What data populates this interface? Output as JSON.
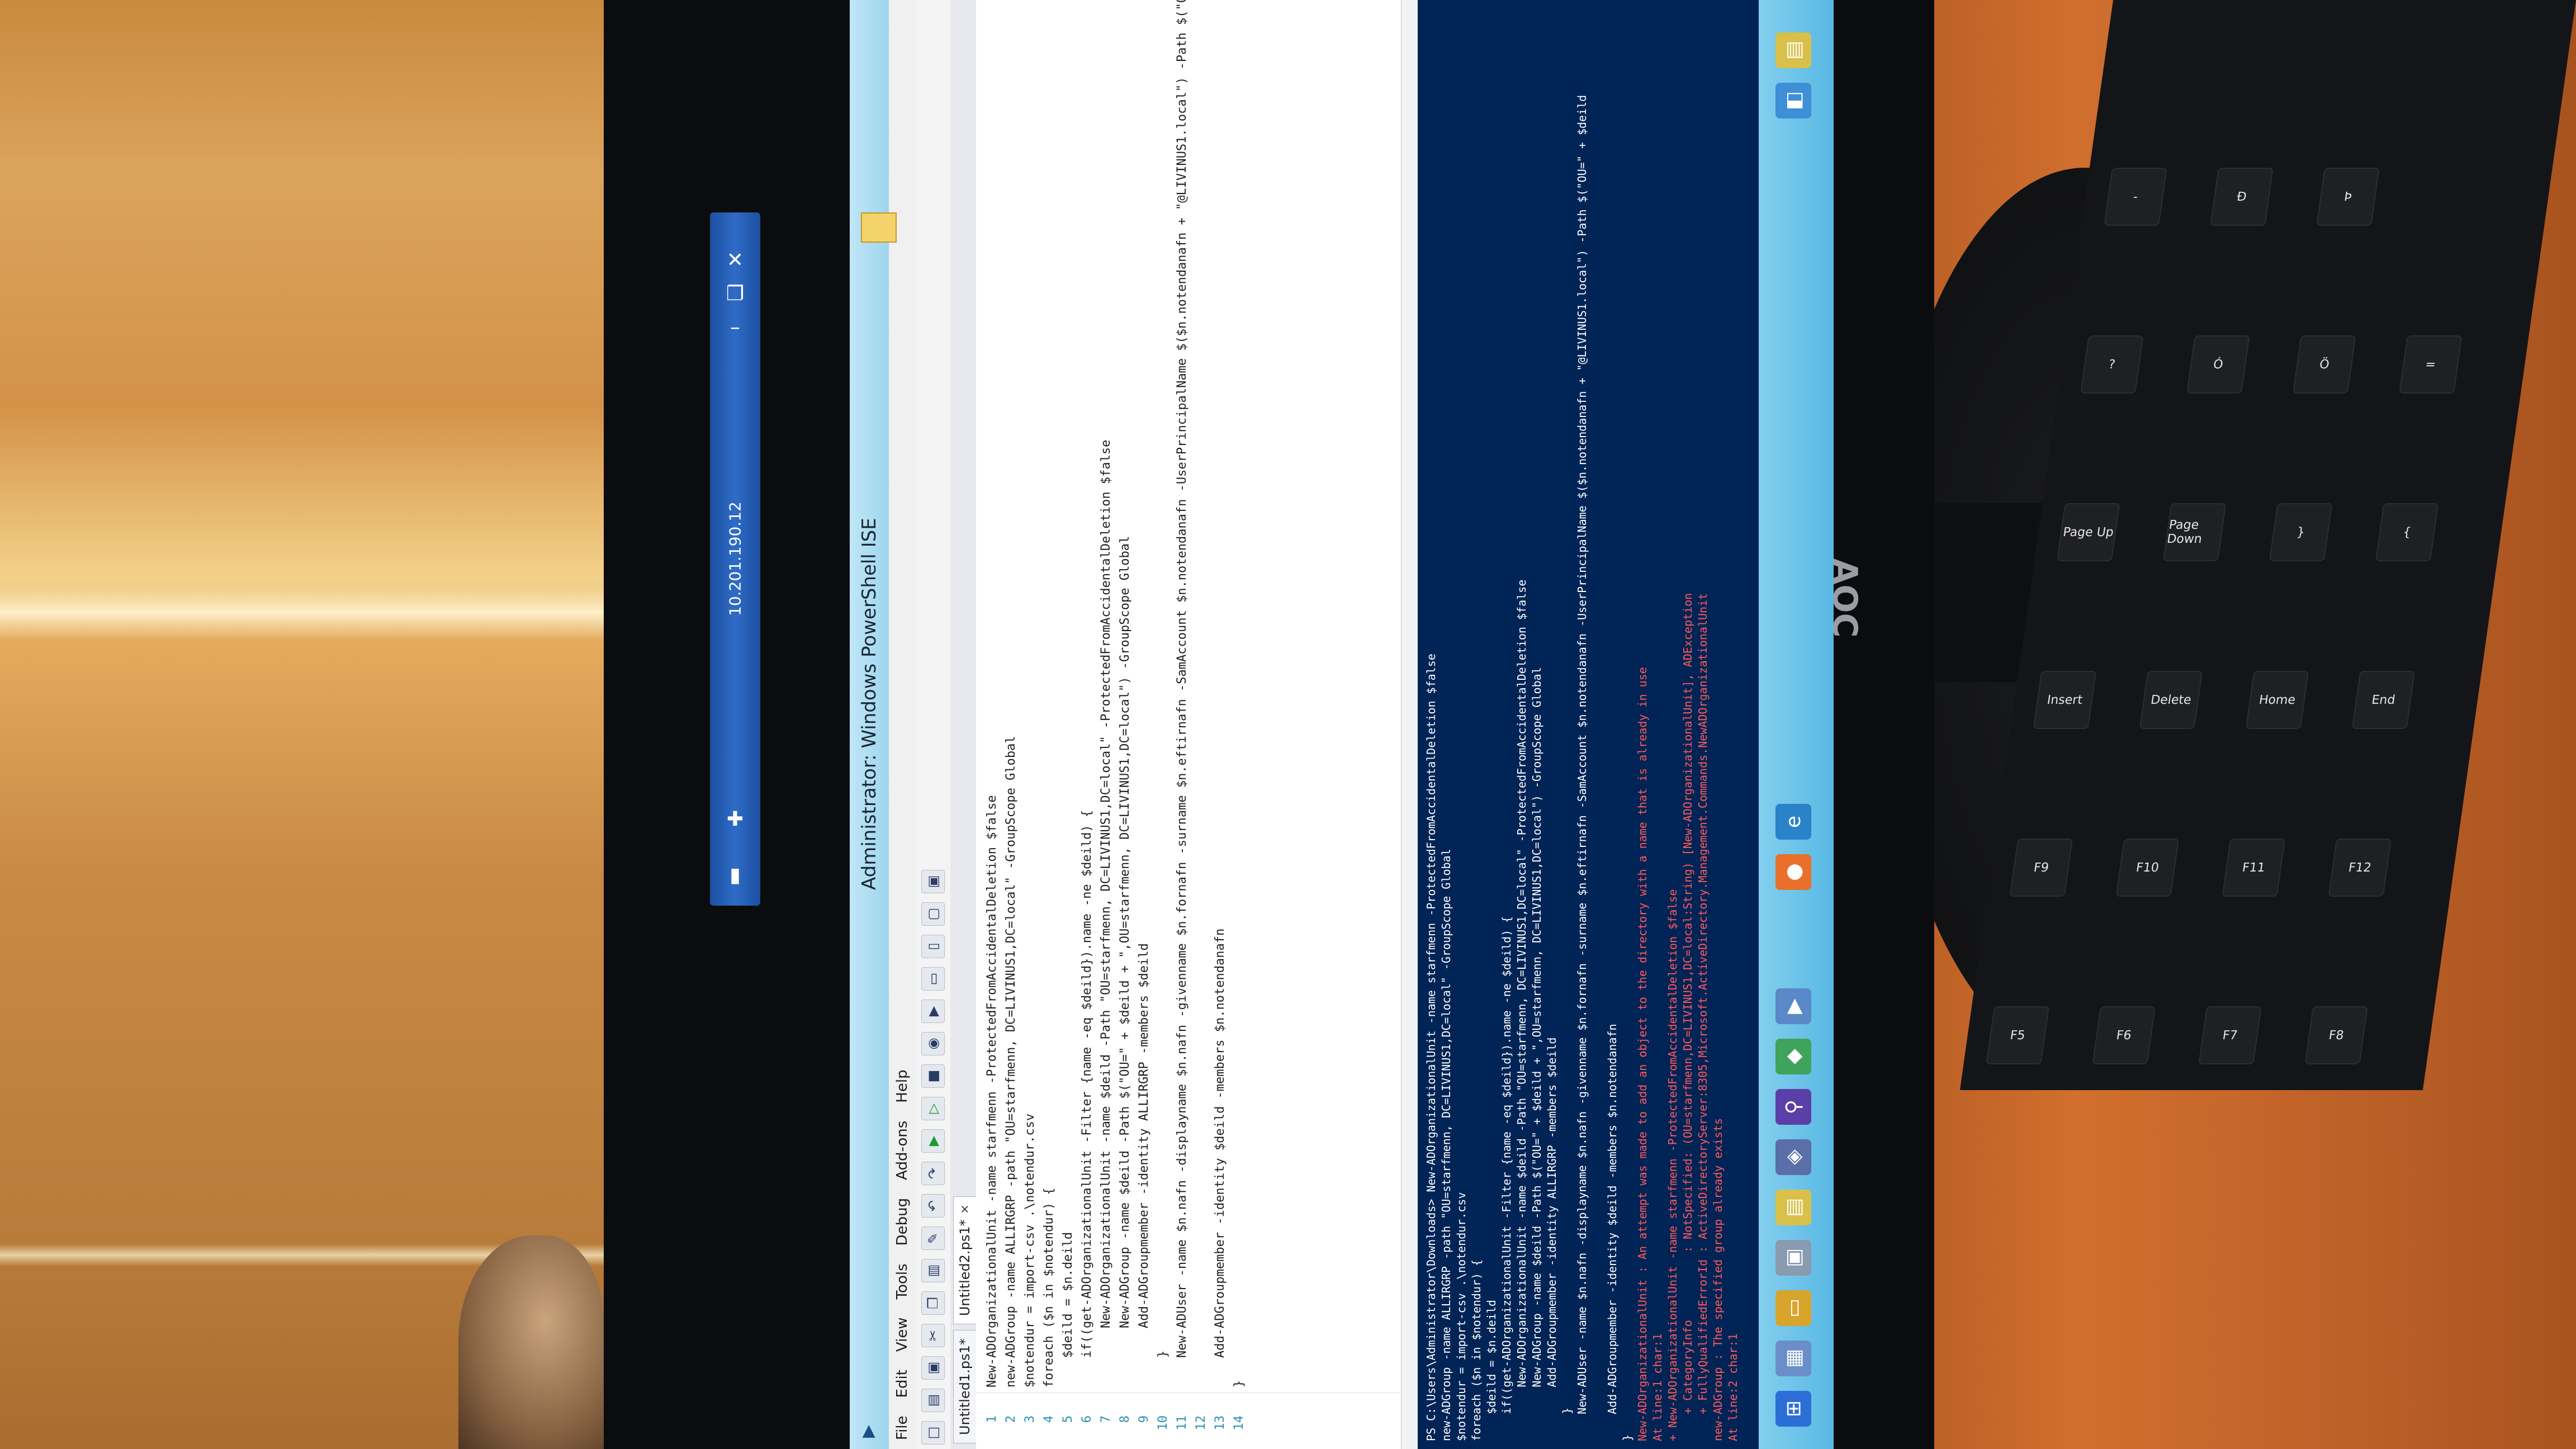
{
  "rdp": {
    "host": "10.201.190.12",
    "icons": [
      "signal-icon",
      "pin-icon",
      "minimize-icon",
      "restore-icon",
      "close-icon"
    ]
  },
  "monitor": {
    "brand": "AOC"
  },
  "ise": {
    "title": "Administrator: Windows PowerShell ISE",
    "menu": [
      "File",
      "Edit",
      "View",
      "Tools",
      "Debug",
      "Add-ons",
      "Help"
    ],
    "tabs": [
      {
        "label": "Untitled1.ps1*",
        "active": false
      },
      {
        "label": "Untitled2.ps1*",
        "active": true
      }
    ],
    "editor_lines": [
      "New-ADOrganizationalUnit -name starfmenn -ProtectedFromAccidentalDeletion $false",
      "new-ADGroup -name ALLIRGRP -path \"OU=starfmenn, DC=LIVINUS1,DC=local\" -GroupScope Global",
      "$notendur = import-csv .\\notendur.csv",
      "foreach ($n in $notendur) {",
      "    $deild = $n.deild",
      "    if((get-ADOrganizationalUnit -Filter {name -eq $deild}).name -ne $deild) {",
      "        New-ADOrganizationalUnit -name $deild -Path \"OU=starfmenn, DC=LIVINUS1,DC=local\" -ProtectedFromAccidentalDeletion $false",
      "        New-ADGroup -name $deild -Path $(\"OU=\" + $deild + \",OU=starfmenn, DC=LIVINUS1,DC=local\") -GroupScope Global",
      "        Add-ADGroupmember -identity ALLIRGRP -members $deild",
      "    }",
      "    New-ADUser -name $n.nafn -displayname $n.nafn -givenname $n.fornafn -surname $n.eftirnafn -SamAccount $n.notendanafn -UserPrincipalName $($n.notendanafn + \"@LIVINUS1.local\") -Path $(\"OU=\" + $deild",
      "",
      "    Add-ADGroupmember -identity $deild -members $n.notendanafn",
      "}"
    ],
    "console_lines": [
      {
        "text": "PS C:\\Users\\Administrator\\Downloads> New-ADOrganizationalUnit -name starfmenn -ProtectedFromAccidentalDeletion $false",
        "err": false
      },
      {
        "text": "new-ADGroup -name ALLIRGRP -path \"OU=starfmenn, DC=LIVINUS1,DC=local\" -GroupScope Global",
        "err": false
      },
      {
        "text": "$notendur = import-csv .\\notendur.csv",
        "err": false
      },
      {
        "text": "foreach ($n in $notendur) {",
        "err": false
      },
      {
        "text": "    $deild = $n.deild",
        "err": false
      },
      {
        "text": "    if((get-ADOrganizationalUnit -Filter {name -eq $deild}).name -ne $deild) {",
        "err": false
      },
      {
        "text": "        New-ADOrganizationalUnit -name $deild -Path \"OU=starfmenn, DC=LIVINUS1,DC=local\" -ProtectedFromAccidentalDeletion $false",
        "err": false
      },
      {
        "text": "        New-ADGroup -name $deild -Path $(\"OU=\" + $deild + \",OU=starfmenn, DC=LIVINUS1,DC=local\") -GroupScope Global",
        "err": false
      },
      {
        "text": "        Add-ADGroupmember -identity ALLIRGRP -members $deild",
        "err": false
      },
      {
        "text": "    }",
        "err": false
      },
      {
        "text": "    New-ADUser -name $n.nafn -displayname $n.nafn -givenname $n.fornafn -surname $n.eftirnafn -SamAccount $n.notendanafn -UserPrincipalName $($n.notendanafn + \"@LIVINUS1.local\") -Path $(\"OU=\" + $deild",
        "err": false
      },
      {
        "text": "",
        "err": false
      },
      {
        "text": "    Add-ADGroupmember -identity $deild -members $n.notendanafn",
        "err": false
      },
      {
        "text": "}",
        "err": false
      },
      {
        "text": "New-ADOrganizationalUnit : An attempt was made to add an object to the directory with a name that is already in use",
        "err": true
      },
      {
        "text": "At line:1 char:1",
        "err": true
      },
      {
        "text": "+ New-ADOrganizationalUnit -name starfmenn -ProtectedFromAccidentalDeletion $false",
        "err": true
      },
      {
        "text": "    + CategoryInfo          : NotSpecified: (OU=starfmenn,DC=LIVINUS1,DC=local:String) [New-ADOrganizationalUnit], ADException",
        "err": true
      },
      {
        "text": "    + FullyQualifiedErrorId : ActiveDirectoryServer:8305,Microsoft.ActiveDirectory.Management.Commands.NewADOrganizationalUnit",
        "err": true
      },
      {
        "text": "new-ADGroup : The specified group already exists",
        "err": true
      },
      {
        "text": "At line:2 char:1",
        "err": true
      }
    ]
  },
  "keyboard": {
    "keys": [
      "F5",
      "F6",
      "F7",
      "F8",
      "F9",
      "F10",
      "F11",
      "F12",
      "Insert",
      "Delete",
      "Home",
      "End",
      "Page Up",
      "Page Down",
      "}",
      "{",
      "?",
      "Ó",
      "Ö",
      "=",
      "-",
      "Ð",
      "Þ"
    ]
  }
}
